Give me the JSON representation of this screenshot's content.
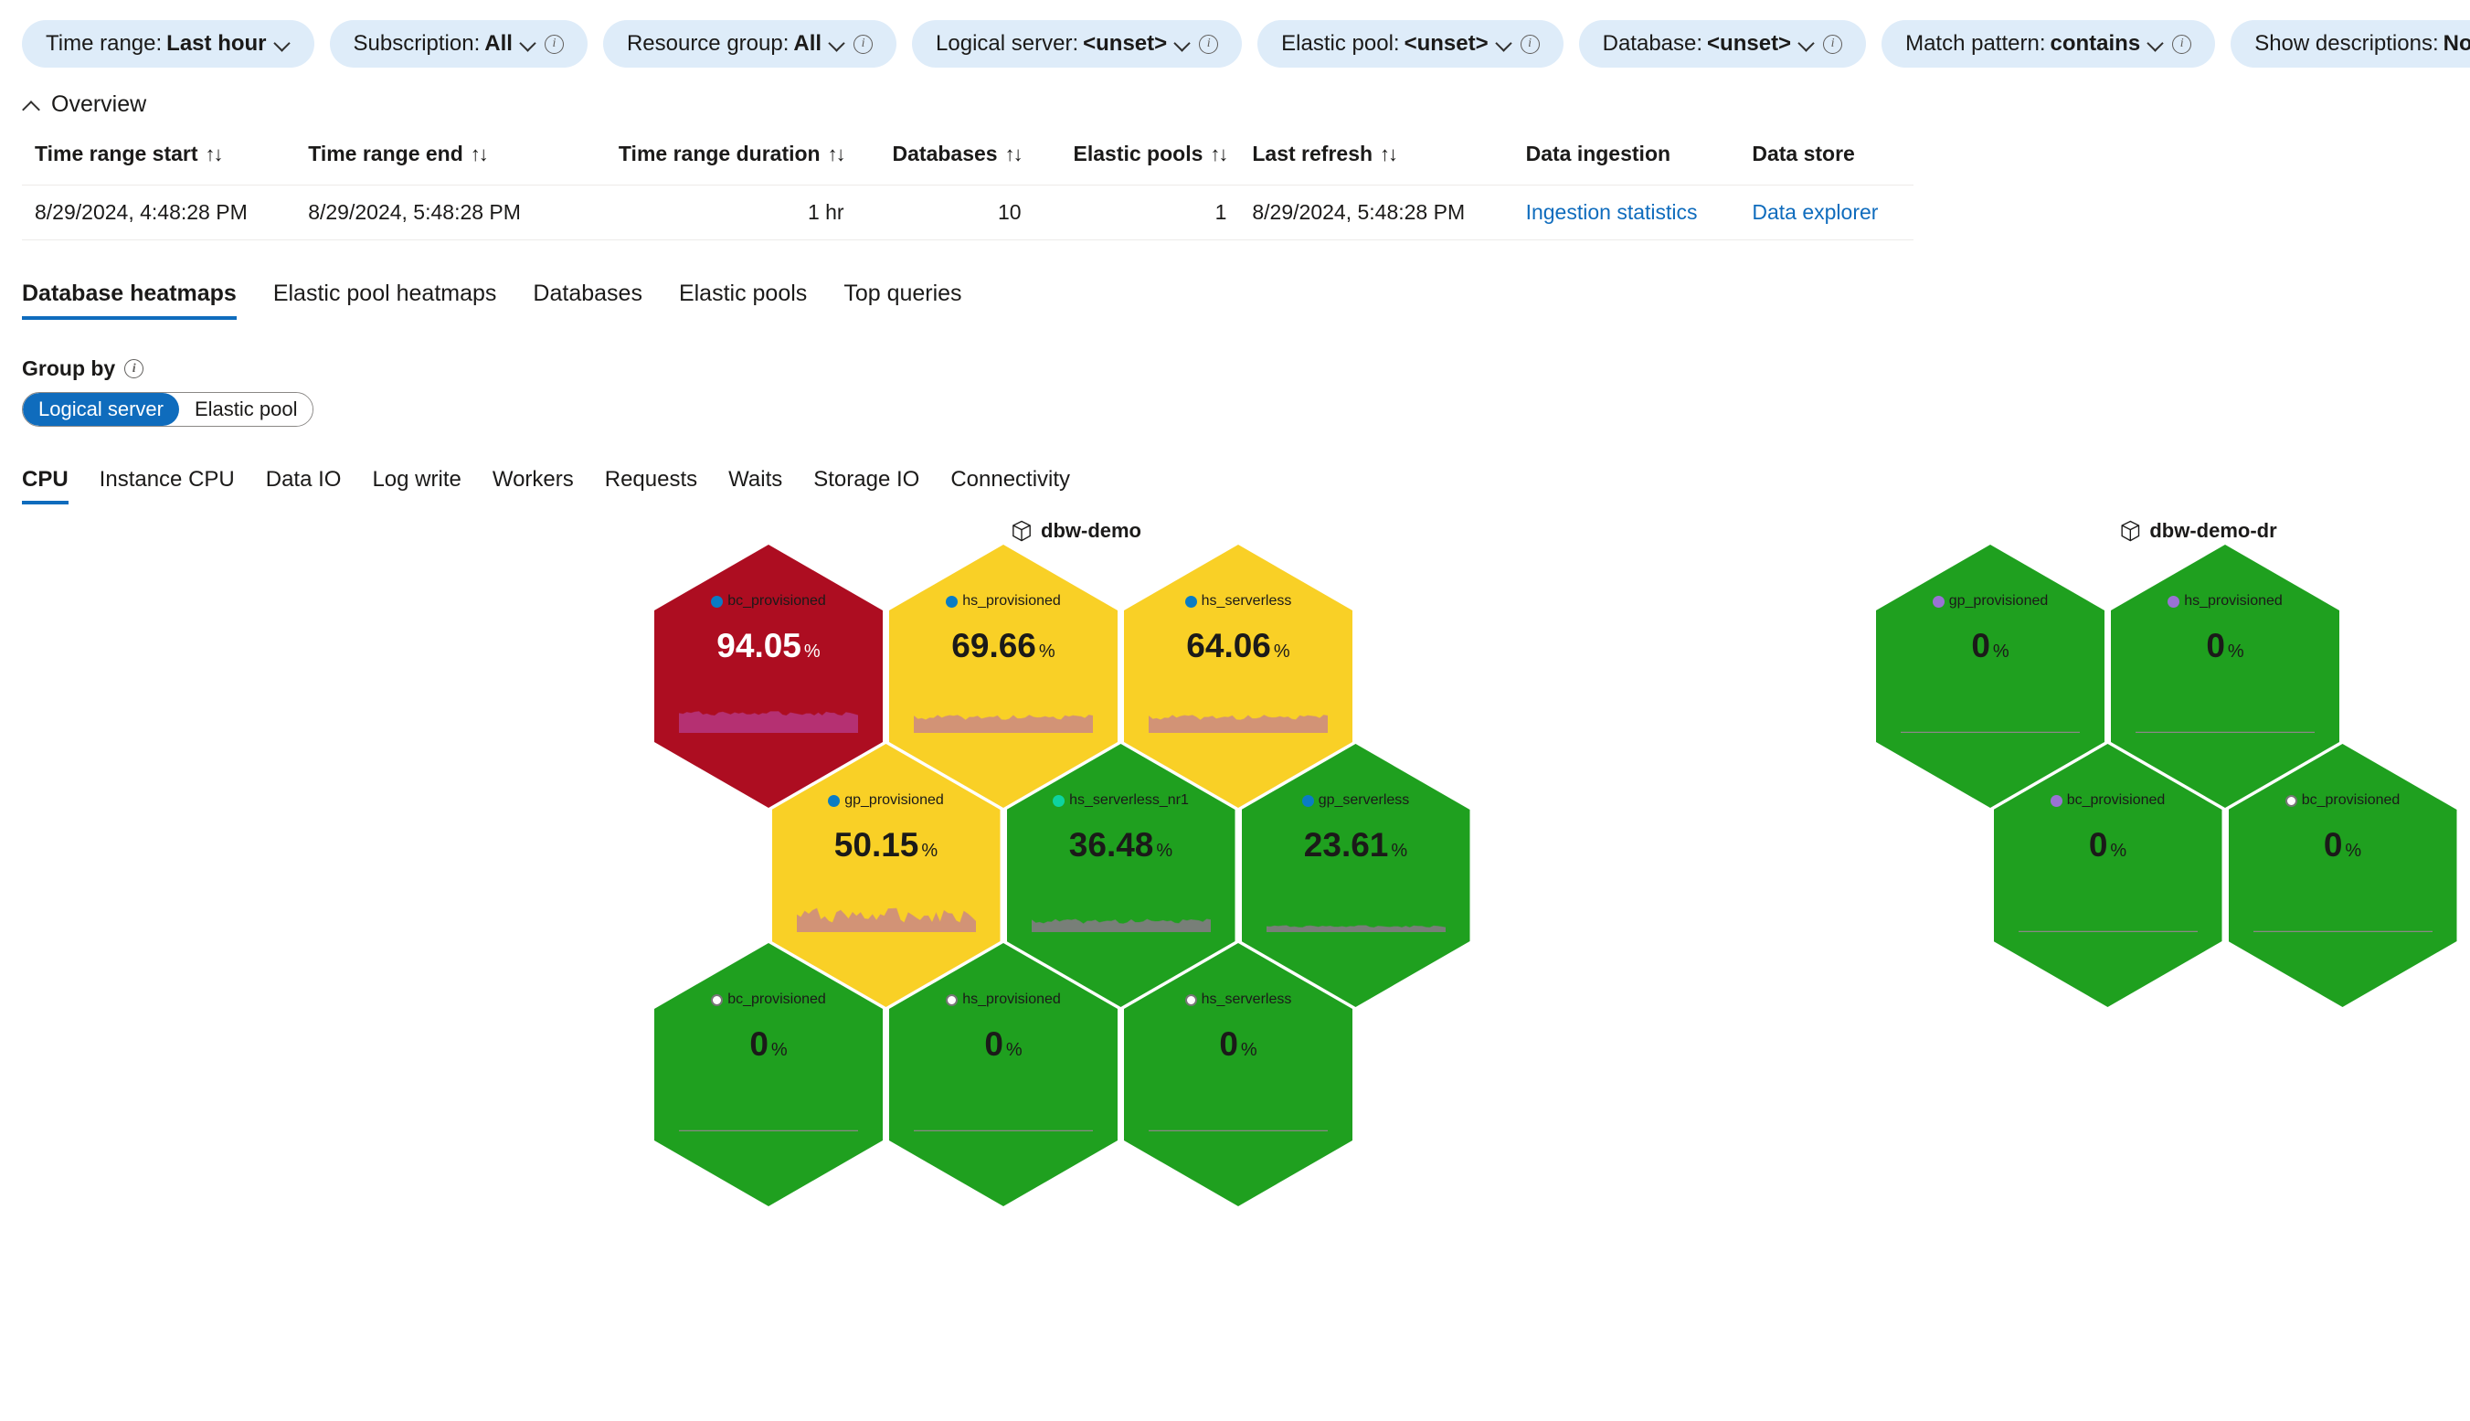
{
  "filters": [
    {
      "label": "Time range:",
      "value": "Last hour",
      "has_info": false,
      "name": "time-range"
    },
    {
      "label": "Subscription:",
      "value": "All",
      "has_info": true,
      "name": "subscription"
    },
    {
      "label": "Resource group:",
      "value": "All",
      "has_info": true,
      "name": "resource-group"
    },
    {
      "label": "Logical server:",
      "value": "<unset>",
      "has_info": true,
      "name": "logical-server"
    },
    {
      "label": "Elastic pool:",
      "value": "<unset>",
      "has_info": true,
      "name": "elastic-pool"
    },
    {
      "label": "Database:",
      "value": "<unset>",
      "has_info": true,
      "name": "database"
    },
    {
      "label": "Match pattern:",
      "value": "contains",
      "has_info": true,
      "name": "match-pattern"
    },
    {
      "label": "Show descriptions:",
      "value": "No",
      "has_info": true,
      "name": "show-descriptions"
    }
  ],
  "overview": {
    "title": "Overview",
    "columns": [
      {
        "label": "Time range start",
        "sortable": true,
        "align": "left"
      },
      {
        "label": "Time range end",
        "sortable": true,
        "align": "left"
      },
      {
        "label": "Time range duration",
        "sortable": true,
        "align": "right"
      },
      {
        "label": "Databases",
        "sortable": true,
        "align": "right"
      },
      {
        "label": "Elastic pools",
        "sortable": true,
        "align": "right"
      },
      {
        "label": "Last refresh",
        "sortable": true,
        "align": "left"
      },
      {
        "label": "Data ingestion",
        "sortable": false,
        "align": "left"
      },
      {
        "label": "Data store",
        "sortable": false,
        "align": "left"
      }
    ],
    "sort_glyph": "↑↓",
    "row": {
      "time_range_start": "8/29/2024, 4:48:28 PM",
      "time_range_end": "8/29/2024, 5:48:28 PM",
      "time_range_duration": "1 hr",
      "databases": "10",
      "elastic_pools": "1",
      "last_refresh": "8/29/2024, 5:48:28 PM",
      "data_ingestion": "Ingestion statistics",
      "data_store": "Data explorer"
    }
  },
  "main_tabs": [
    {
      "label": "Database heatmaps",
      "active": true
    },
    {
      "label": "Elastic pool heatmaps",
      "active": false
    },
    {
      "label": "Databases",
      "active": false
    },
    {
      "label": "Elastic pools",
      "active": false
    },
    {
      "label": "Top queries",
      "active": false
    }
  ],
  "group_by": {
    "label": "Group by",
    "options": [
      {
        "label": "Logical server",
        "selected": true
      },
      {
        "label": "Elastic pool",
        "selected": false
      }
    ]
  },
  "metric_tabs": [
    {
      "label": "CPU",
      "active": true
    },
    {
      "label": "Instance CPU",
      "active": false
    },
    {
      "label": "Data IO",
      "active": false
    },
    {
      "label": "Log write",
      "active": false
    },
    {
      "label": "Workers",
      "active": false
    },
    {
      "label": "Requests",
      "active": false
    },
    {
      "label": "Waits",
      "active": false
    },
    {
      "label": "Storage IO",
      "active": false
    },
    {
      "label": "Connectivity",
      "active": false
    }
  ],
  "colors": {
    "red": "#ad0d21",
    "yellow": "#f9d026",
    "green": "#1fa01f",
    "accent_blue": "#0f6cbd",
    "dot_blue": "#0a7cc4",
    "dot_teal": "#0ed3a0",
    "dot_purple": "#9a72d4",
    "spark_red": "#b53377",
    "spark_yellow": "#d08f7a",
    "spark_green": "#7d7d7d"
  },
  "chart_data": {
    "type": "heatmap",
    "title": "CPU",
    "unit": "%",
    "group_by": "Logical server",
    "clusters": [
      {
        "name": "dbw-demo",
        "cells": [
          {
            "label": "bc_provisioned",
            "value": 94.05,
            "display": "94.05",
            "color": "#ad0d21",
            "band": "red",
            "dot": "#0a7cc4",
            "dot_style": "solid",
            "text_color": "#ffffff",
            "spark": "high"
          },
          {
            "label": "hs_provisioned",
            "value": 69.66,
            "display": "69.66",
            "color": "#f9d026",
            "band": "yellow",
            "dot": "#0a7cc4",
            "dot_style": "solid",
            "text_color": "#1b1a19",
            "spark": "mid"
          },
          {
            "label": "hs_serverless",
            "value": 64.06,
            "display": "64.06",
            "color": "#f9d026",
            "band": "yellow",
            "dot": "#0a7cc4",
            "dot_style": "solid",
            "text_color": "#1b1a19",
            "spark": "mid"
          },
          {
            "label": "gp_provisioned",
            "value": 50.15,
            "display": "50.15",
            "color": "#f9d026",
            "band": "yellow",
            "dot": "#0a7cc4",
            "dot_style": "solid",
            "text_color": "#1b1a19",
            "spark": "wavy"
          },
          {
            "label": "hs_serverless_nr1",
            "value": 36.48,
            "display": "36.48",
            "color": "#1fa01f",
            "band": "green",
            "dot": "#0ed3a0",
            "dot_style": "solid",
            "text_color": "#1b1a19",
            "spark": "low"
          },
          {
            "label": "gp_serverless",
            "value": 23.61,
            "display": "23.61",
            "color": "#1fa01f",
            "band": "green",
            "dot": "#0a7cc4",
            "dot_style": "solid",
            "text_color": "#1b1a19",
            "spark": "flat"
          },
          {
            "label": "bc_provisioned",
            "value": 0,
            "display": "0",
            "color": "#1fa01f",
            "band": "green",
            "dot": "#ffffff",
            "dot_style": "hollow",
            "text_color": "#1b1a19",
            "spark": "zero"
          },
          {
            "label": "hs_provisioned",
            "value": 0,
            "display": "0",
            "color": "#1fa01f",
            "band": "green",
            "dot": "#ffffff",
            "dot_style": "hollow",
            "text_color": "#1b1a19",
            "spark": "zero"
          },
          {
            "label": "hs_serverless",
            "value": 0,
            "display": "0",
            "color": "#1fa01f",
            "band": "green",
            "dot": "#ffffff",
            "dot_style": "hollow",
            "text_color": "#1b1a19",
            "spark": "zero"
          }
        ]
      },
      {
        "name": "dbw-demo-dr",
        "cells": [
          {
            "label": "gp_provisioned",
            "value": 0,
            "display": "0",
            "color": "#1fa01f",
            "band": "green",
            "dot": "#9a72d4",
            "dot_style": "solid",
            "text_color": "#1b1a19",
            "spark": "zero"
          },
          {
            "label": "hs_provisioned",
            "value": 0,
            "display": "0",
            "color": "#1fa01f",
            "band": "green",
            "dot": "#9a72d4",
            "dot_style": "solid",
            "text_color": "#1b1a19",
            "spark": "zero"
          },
          {
            "label": "bc_provisioned",
            "value": 0,
            "display": "0",
            "color": "#1fa01f",
            "band": "green",
            "dot": "#9a72d4",
            "dot_style": "solid",
            "text_color": "#1b1a19",
            "spark": "zero"
          },
          {
            "label": "bc_provisioned",
            "value": 0,
            "display": "0",
            "color": "#1fa01f",
            "band": "green",
            "dot": "#ffffff",
            "dot_style": "hollow",
            "text_color": "#1b1a19",
            "spark": "zero"
          }
        ]
      }
    ]
  }
}
